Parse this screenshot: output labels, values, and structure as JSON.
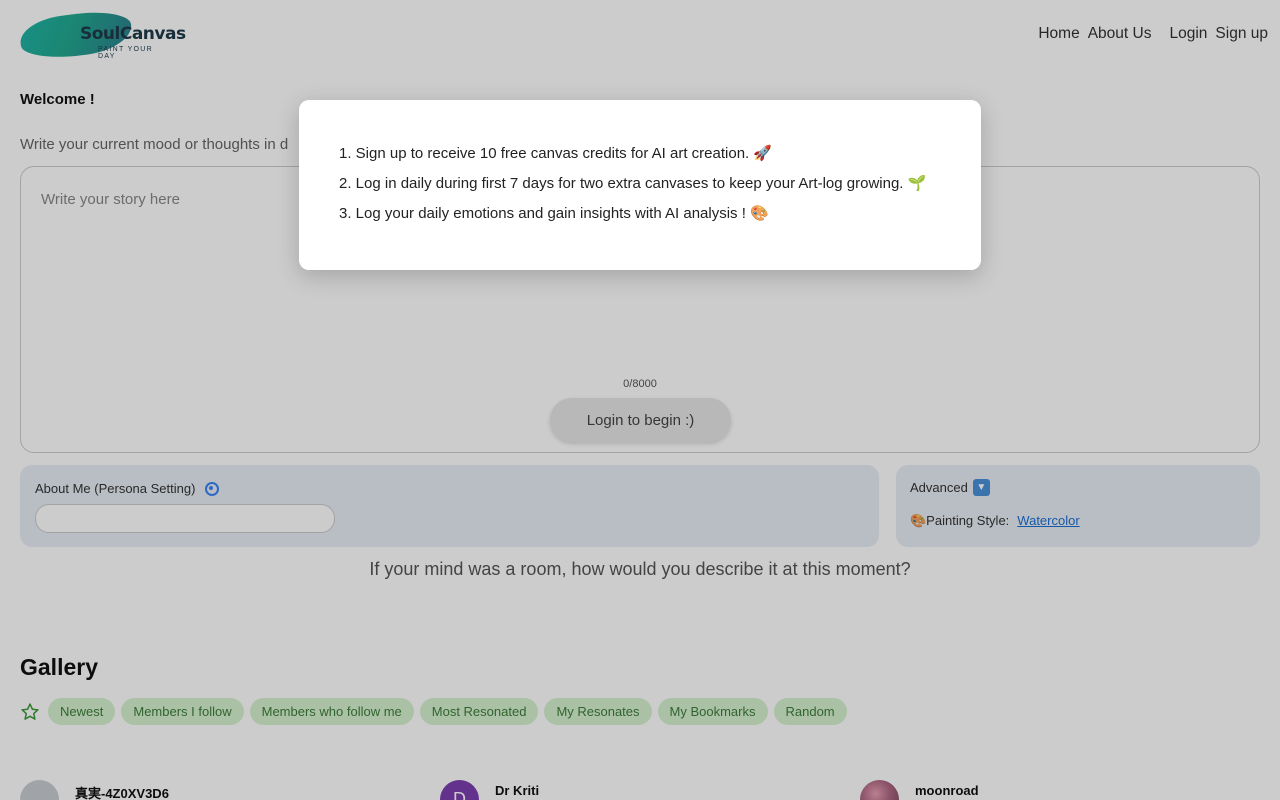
{
  "header": {
    "logo_text": "SoulCanvas",
    "logo_tagline": "PAINT YOUR DAY",
    "nav": [
      "Home",
      "About Us",
      "Login",
      "Sign up"
    ]
  },
  "welcome": "Welcome !",
  "prompt_hint": "Write your current mood or thoughts in d",
  "story": {
    "placeholder": "Write your story here",
    "counter": "0/8000",
    "begin_label": "Login to begin :)"
  },
  "persona": {
    "label": "About Me (Persona Setting)",
    "icon": "gear-icon"
  },
  "advanced": {
    "label": "Advanced",
    "toggle": "▼",
    "style_label": "🎨Painting Style:",
    "style_value": "Watercolor"
  },
  "question": "If your mind was a room, how would you describe it at this moment?",
  "gallery": {
    "title": "Gallery",
    "filters": [
      "Newest",
      "Members I follow",
      "Members who follow me",
      "Most Resonated",
      "My Resonates",
      "My Bookmarks",
      "Random"
    ],
    "users": [
      {
        "name": "真実-4Z0XV3D6"
      },
      {
        "name": "Dr Kriti",
        "initial": "D"
      },
      {
        "name": "moonroad"
      }
    ]
  },
  "modal": {
    "lines": [
      "1. Sign up to receive 10 free canvas credits for AI art creation. 🚀",
      "2. Log in daily during first 7 days for two extra canvases to keep your Art-log growing. 🌱",
      "3. Log your daily emotions and gain insights with AI analysis ! 🎨"
    ]
  },
  "colors": {
    "chip_bg": "#d6f2d0",
    "chip_text": "#3c7d3a",
    "link": "#1d6fd1",
    "card_bg": "#e8eef6"
  }
}
